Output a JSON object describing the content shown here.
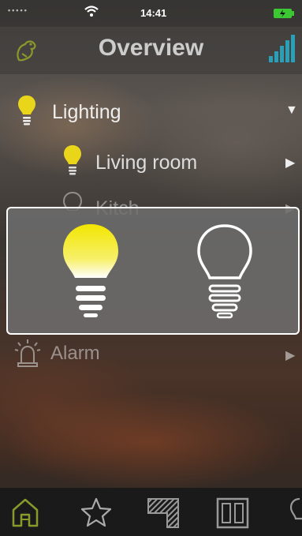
{
  "status_bar": {
    "time": "14:41"
  },
  "header": {
    "title": "Overview"
  },
  "menu": {
    "lighting": {
      "label": "Lighting"
    },
    "living_room": {
      "label": "Living room"
    },
    "kitchen": {
      "label": "Kitch"
    },
    "alarm": {
      "label": "Alarm"
    }
  },
  "colors": {
    "accent_green": "#8a9a2a",
    "signal_teal": "#2aa0b8",
    "bulb_yellow": "#f2e600",
    "battery_green": "#3cc832"
  },
  "icons": {
    "status": [
      "wifi-icon",
      "battery-icon"
    ],
    "header": [
      "frog-icon",
      "signal-bars-icon"
    ],
    "tabs": [
      "home-icon",
      "star-icon",
      "rooms-icon",
      "devices-icon",
      "lightbulb-icon"
    ]
  }
}
